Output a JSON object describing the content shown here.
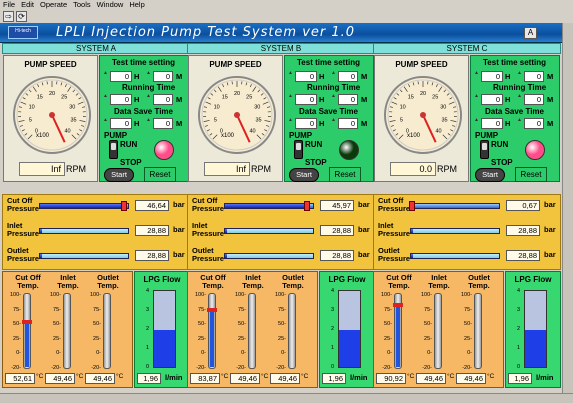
{
  "menu": [
    "File",
    "Edit",
    "Operate",
    "Tools",
    "Window",
    "Help"
  ],
  "toolbar": {
    "run_icon": "run-arrow-icon",
    "run_cont_icon": "run-continuous-icon"
  },
  "header": {
    "logo": "Hi-tech",
    "title": "LPLI Injection Pump Test System ver 1.0"
  },
  "labels": {
    "pump_speed": "PUMP SPEED",
    "test_time": "Test time setting",
    "running_time": "Running Time",
    "data_save": "Data Save Time",
    "pump": "PUMP",
    "run": "RUN",
    "stop": "STOP",
    "start": "Start",
    "reset": "Reset",
    "rpm": "RPM",
    "bar": "bar",
    "cutoff_pressure": [
      "Cut Off",
      "Pressure"
    ],
    "inlet_pressure": [
      "Inlet",
      "Pressure"
    ],
    "outlet_pressure": [
      "Outlet",
      "Pressure"
    ],
    "cutoff_temp": [
      "Cut Off",
      "Temp."
    ],
    "inlet_temp": [
      "Inlet",
      "Temp."
    ],
    "outlet_temp": [
      "Outlet",
      "Temp."
    ],
    "lpg_flow": "LPG Flow",
    "lmin": "l/min",
    "degc": "°C",
    "H": "H",
    "M": "M",
    "x100": "x100"
  },
  "gauge_ticks": [
    "0",
    "5",
    "10",
    "15",
    "20",
    "25",
    "30",
    "35",
    "40"
  ],
  "temp_ticks": [
    "100-",
    "75-",
    "50-",
    "25-",
    "0-",
    "-20-"
  ],
  "lpg_ticks": [
    "4",
    "3",
    "2",
    "1",
    "0"
  ],
  "systems": [
    {
      "name": "SYSTEM A",
      "rpm": "Inf",
      "needle_deg": 155,
      "test_h": "0",
      "test_m": "0",
      "run_h": "0",
      "run_m": "0",
      "save_h": "0",
      "save_m": "0",
      "led_color": "#ff4d8a",
      "cutoff_pressure": "46,64",
      "inlet_pressure": "28,88",
      "outlet_pressure": "28,88",
      "cutoff_fill": 95,
      "inlet_fill": 2,
      "outlet_fill": 2,
      "cutoff_temp": "52,61",
      "inlet_temp": "49,46",
      "outlet_temp": "49,46",
      "cutoff_tfill": 62,
      "inlet_tfill": 0,
      "outlet_tfill": 0,
      "lpg_flow": "1,96",
      "lpg_level": 0.49
    },
    {
      "name": "SYSTEM B",
      "rpm": "Inf",
      "needle_deg": 155,
      "test_h": "0",
      "test_m": "0",
      "run_h": "0",
      "run_m": "0",
      "save_h": "0",
      "save_m": "0",
      "led_color": "#0a3a0a",
      "cutoff_pressure": "45,97",
      "inlet_pressure": "28,88",
      "outlet_pressure": "28,88",
      "cutoff_fill": 93,
      "inlet_fill": 2,
      "outlet_fill": 2,
      "cutoff_temp": "83,87",
      "inlet_temp": "49,46",
      "outlet_temp": "49,46",
      "cutoff_tfill": 78,
      "inlet_tfill": 0,
      "outlet_tfill": 0,
      "lpg_flow": "1,96",
      "lpg_level": 0.49
    },
    {
      "name": "SYSTEM C",
      "rpm": "0.0",
      "needle_deg": 155,
      "test_h": "0",
      "test_m": "0",
      "run_h": "0",
      "run_m": "0",
      "save_h": "0",
      "save_m": "0",
      "led_color": "#ff4d8a",
      "cutoff_pressure": "0,67",
      "inlet_pressure": "28,88",
      "outlet_pressure": "28,88",
      "cutoff_fill": 1,
      "inlet_fill": 2,
      "outlet_fill": 2,
      "cutoff_temp": "90,92",
      "inlet_temp": "49,46",
      "outlet_temp": "49,46",
      "cutoff_tfill": 85,
      "inlet_tfill": 0,
      "outlet_tfill": 0,
      "lpg_flow": "1,96",
      "lpg_level": 0.49
    }
  ]
}
